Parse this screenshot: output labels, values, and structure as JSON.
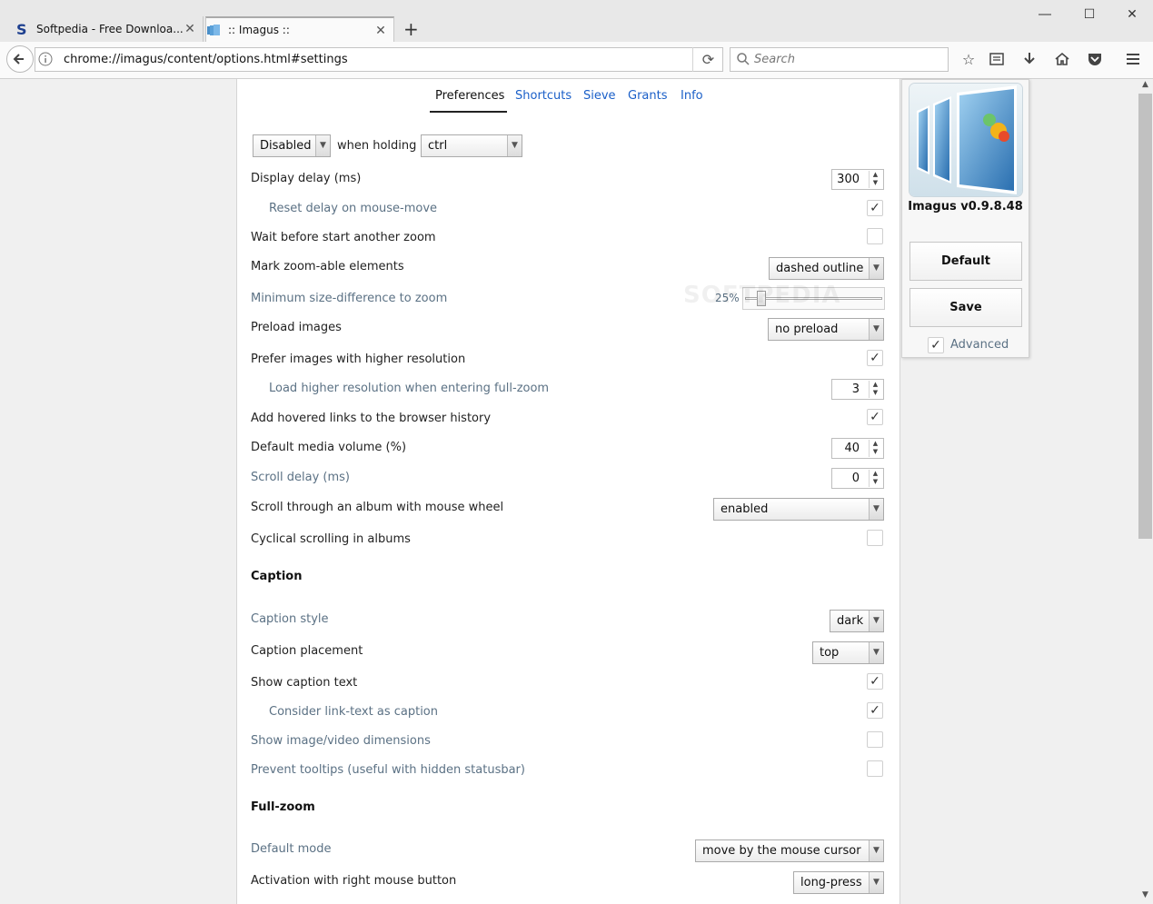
{
  "tabs": [
    {
      "title": "Softpedia - Free Downloa...",
      "favicon": "softpedia-logo-icon"
    },
    {
      "title": ":: Imagus ::",
      "favicon": "imagus-icon"
    }
  ],
  "window_controls": {
    "minimize": "minimize-icon",
    "maximize": "maximize-icon",
    "close": "close-icon"
  },
  "navbar": {
    "url": "chrome://imagus/content/options.html#settings",
    "search_placeholder": "Search",
    "toolbar_icons": [
      "bookmark-star-icon",
      "reading-list-icon",
      "download-icon",
      "home-icon",
      "pocket-icon",
      "menu-icon"
    ]
  },
  "settings_nav": {
    "items": [
      "Preferences",
      "Shortcuts",
      "Sieve",
      "Grants",
      "Info"
    ],
    "active": "Preferences"
  },
  "activation": {
    "mode": "Disabled",
    "when_holding_label": "when holding",
    "key": "ctrl"
  },
  "rows": {
    "display_delay": {
      "label": "Display delay (ms)",
      "value": "300"
    },
    "reset_delay": {
      "label": "Reset delay on mouse-move",
      "checked": true
    },
    "wait_before_zoom": {
      "label": "Wait before start another zoom",
      "checked": false
    },
    "mark_zoomable": {
      "label": "Mark zoom-able elements",
      "value": "dashed outline"
    },
    "min_size_diff": {
      "label": "Minimum size-difference to zoom",
      "value": "25%",
      "level": 0.1
    },
    "preload": {
      "label": "Preload images",
      "value": "no preload"
    },
    "prefer_high_res": {
      "label": "Prefer images with higher resolution",
      "checked": true
    },
    "load_high_res": {
      "label": "Load higher resolution when entering full-zoom",
      "value": "3"
    },
    "hovered_history": {
      "label": "Add hovered links to the browser history",
      "checked": true
    },
    "media_volume": {
      "label": "Default media volume (%)",
      "value": "40"
    },
    "scroll_delay": {
      "label": "Scroll delay (ms)",
      "value": "0"
    },
    "album_wheel": {
      "label": "Scroll through an album with mouse wheel",
      "value": "enabled"
    },
    "cyclical_scroll": {
      "label": "Cyclical scrolling in albums",
      "checked": false
    }
  },
  "caption": {
    "header": "Caption",
    "style": {
      "label": "Caption style",
      "value": "dark"
    },
    "placement": {
      "label": "Caption placement",
      "value": "top"
    },
    "show_text": {
      "label": "Show caption text",
      "checked": true
    },
    "link_text": {
      "label": "Consider link-text as caption",
      "checked": true
    },
    "dimensions": {
      "label": "Show image/video dimensions",
      "checked": false
    },
    "tooltips": {
      "label": "Prevent tooltips (useful with hidden statusbar)",
      "checked": false
    }
  },
  "fullzoom": {
    "header": "Full-zoom",
    "default_mode": {
      "label": "Default mode",
      "value": "move by the mouse cursor"
    },
    "right_button": {
      "label": "Activation with right mouse button",
      "value": "long-press"
    }
  },
  "sidebar": {
    "version": "Imagus v0.9.8.48",
    "default_label": "Default",
    "save_label": "Save",
    "advanced_label": "Advanced",
    "advanced_checked": true
  },
  "watermark": "SOFTPEDIA"
}
